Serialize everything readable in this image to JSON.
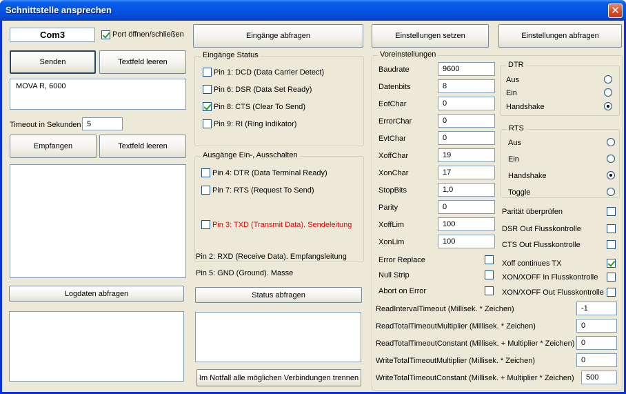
{
  "window": {
    "title": "Schnittstelle ansprechen"
  },
  "left": {
    "com_port": "Com3",
    "port_toggle_label": "Port öffnen/schließen",
    "send_label": "Senden",
    "clear_send_label": "Textfeld leeren",
    "send_text": "MOVA R, 6000",
    "timeout_label": "Timeout in Sekunden",
    "timeout_value": "5",
    "receive_label": "Empfangen",
    "clear_receive_label": "Textfeld leeren",
    "log_label": "Logdaten abfragen"
  },
  "middle": {
    "query_inputs_label": "Eingänge abfragen",
    "inputs_group": "Eingänge Status",
    "inputs": [
      {
        "label": "Pin 1: DCD (Data Carrier Detect)",
        "checked": false
      },
      {
        "label": "Pin 6: DSR (Data Set Ready)",
        "checked": false
      },
      {
        "label": "Pin 8: CTS (Clear To Send)",
        "checked": true
      },
      {
        "label": "Pin 9: RI (Ring Indikator)",
        "checked": false
      }
    ],
    "outputs_group": "Ausgänge Ein-, Ausschalten",
    "outputs": [
      {
        "label": "Pin 4: DTR (Data Terminal Ready)",
        "checked": false
      },
      {
        "label": "Pin 7: RTS (Request To Send)",
        "checked": false
      },
      {
        "label": "Pin 3: TXD (Transmit Data). Sendeleitung",
        "checked": false
      }
    ],
    "pin2_text": "Pin 2: RXD (Receive Data). Empfangsleitung",
    "pin5_text": "Pin 5: GND (Ground). Masse",
    "status_label": "Status abfragen",
    "emergency_label": "Im Notfall alle möglichen Verbindungen trennen"
  },
  "right": {
    "set_settings_label": "Einstellungen setzen",
    "query_settings_label": "Einstellungen abfragen",
    "presets_group": "Voreinstellungen",
    "fields": [
      {
        "label": "Baudrate",
        "value": "9600"
      },
      {
        "label": "Datenbits",
        "value": "8"
      },
      {
        "label": "EofChar",
        "value": "0"
      },
      {
        "label": "ErrorChar",
        "value": "0"
      },
      {
        "label": "EvtChar",
        "value": "0"
      },
      {
        "label": "XoffChar",
        "value": "19"
      },
      {
        "label": "XonChar",
        "value": "17"
      },
      {
        "label": "StopBits",
        "value": "1,0"
      },
      {
        "label": "Parity",
        "value": "0"
      },
      {
        "label": "XoffLim",
        "value": "100"
      },
      {
        "label": "XonLim",
        "value": "100"
      }
    ],
    "dtr_group": "DTR",
    "dtr_options": [
      {
        "label": "Aus",
        "selected": false
      },
      {
        "label": "Ein",
        "selected": false
      },
      {
        "label": "Handshake",
        "selected": true
      }
    ],
    "rts_group": "RTS",
    "rts_options": [
      {
        "label": "Aus",
        "selected": false
      },
      {
        "label": "Ein",
        "selected": false
      },
      {
        "label": "Handshake",
        "selected": true
      },
      {
        "label": "Toggle",
        "selected": false
      }
    ],
    "flags_right": [
      {
        "label": "Parität überprüfen",
        "checked": false
      },
      {
        "label": "DSR Out Flusskontrolle",
        "checked": false
      },
      {
        "label": "CTS Out Flusskontrolle",
        "checked": false
      },
      {
        "label": "Xoff continues TX",
        "checked": true
      },
      {
        "label": "XON/XOFF In Flusskontrolle",
        "checked": false
      },
      {
        "label": "XON/XOFF Out Flusskontrolle",
        "checked": false
      }
    ],
    "flags_left": [
      {
        "label": "Error Replace",
        "checked": false
      },
      {
        "label": "Null Strip",
        "checked": false
      },
      {
        "label": "Abort on Error",
        "checked": false
      }
    ],
    "timeouts": [
      {
        "label": "ReadIntervalTimeout (Millisek. * Zeichen)",
        "value": "-1"
      },
      {
        "label": "ReadTotalTimeoutMultiplier (Millisek. * Zeichen)",
        "value": "0"
      },
      {
        "label": "ReadTotalTimeoutConstant (Millisek. + Multiplier * Zeichen)",
        "value": "0"
      },
      {
        "label": "WriteTotalTimeoutMultiplier  (Millisek.  * Zeichen)",
        "value": "0"
      },
      {
        "label": "WriteTotalTimeoutConstant  (Millisek. + Multiplier * Zeichen)",
        "value": "500"
      }
    ]
  },
  "colors": {
    "titlebar": "#0554e3",
    "face": "#ece9d8",
    "warning_text": "#e00000"
  }
}
